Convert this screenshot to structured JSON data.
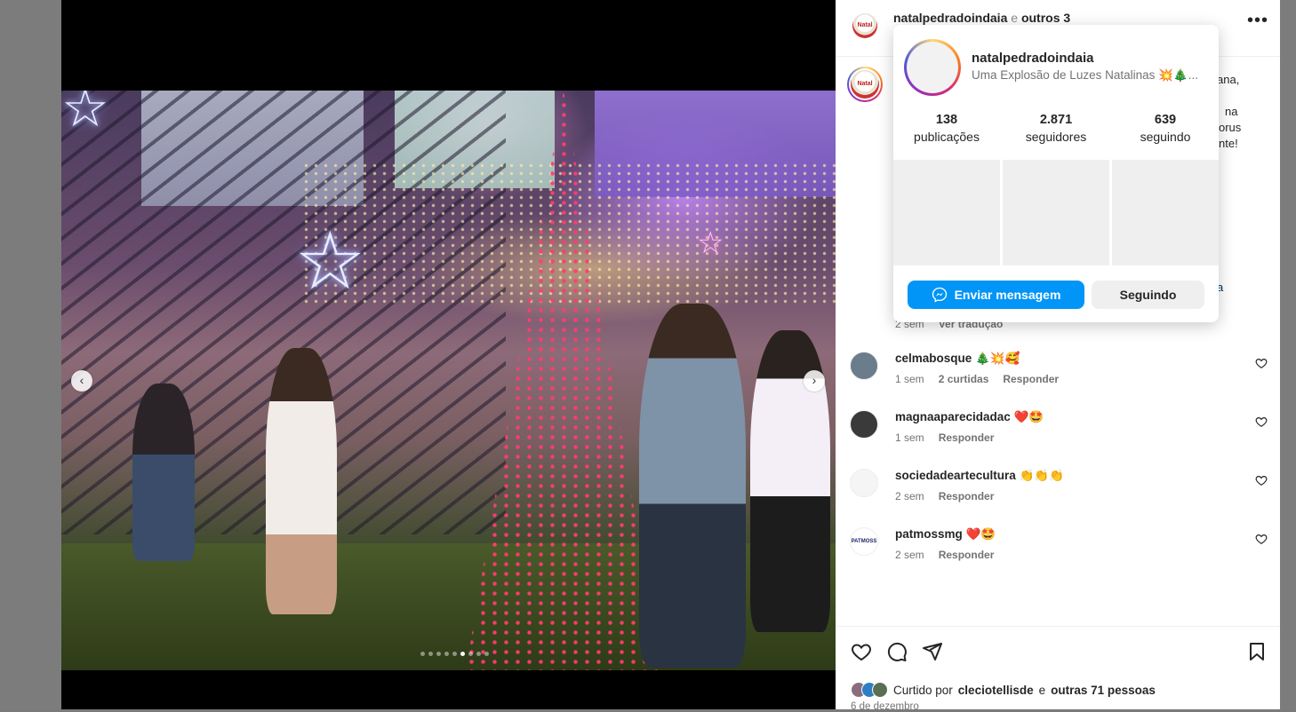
{
  "post_header": {
    "username": "natalpedradoindaia",
    "joiner": "e",
    "others": "outros 3",
    "logo_text": "Natal"
  },
  "caption_fragments": {
    "line1": "ana,",
    "line2": "na",
    "line3": "orus",
    "line4": "nte!",
    "link_frag": "a"
  },
  "caption_meta": {
    "time": "2 sem",
    "translate": "Ver tradução"
  },
  "carousel": {
    "dots": 9,
    "active_index": 5
  },
  "popup": {
    "username": "natalpedradoindaia",
    "bio": "Uma Explosão de Luzes Natalinas 💥🎄...",
    "stats": [
      {
        "value": "138",
        "label": "publicações"
      },
      {
        "value": "2.871",
        "label": "seguidores"
      },
      {
        "value": "639",
        "label": "seguindo"
      }
    ],
    "send_message": "Enviar mensagem",
    "following": "Seguindo"
  },
  "comments": [
    {
      "user": "celmabosque",
      "text": "🎄💥🥰",
      "time": "1 sem",
      "likes": "2 curtidas",
      "reply": "Responder",
      "avatar_color": "#6b7c8c"
    },
    {
      "user": "magnaaparecidadac",
      "text": "❤️🤩",
      "time": "1 sem",
      "likes": "",
      "reply": "Responder",
      "avatar_color": "#3a3a3a"
    },
    {
      "user": "sociedadeartecultura",
      "text": "👏👏👏",
      "time": "2 sem",
      "likes": "",
      "reply": "Responder",
      "avatar_color": "#f5f5f5"
    },
    {
      "user": "patmossmg",
      "text": "❤️🤩",
      "time": "2 sem",
      "likes": "",
      "reply": "Responder",
      "avatar_color": "#ffffff",
      "avatar_text": "PATMOSS"
    }
  ],
  "likes": {
    "prefix": "Curtido por",
    "user": "cleciotellisde",
    "joiner": "e",
    "others": "outras 71 pessoas"
  },
  "date": "6 de dezembro",
  "colors": {
    "primary_blue": "#0095f6",
    "text": "#262626",
    "muted": "#737373"
  }
}
